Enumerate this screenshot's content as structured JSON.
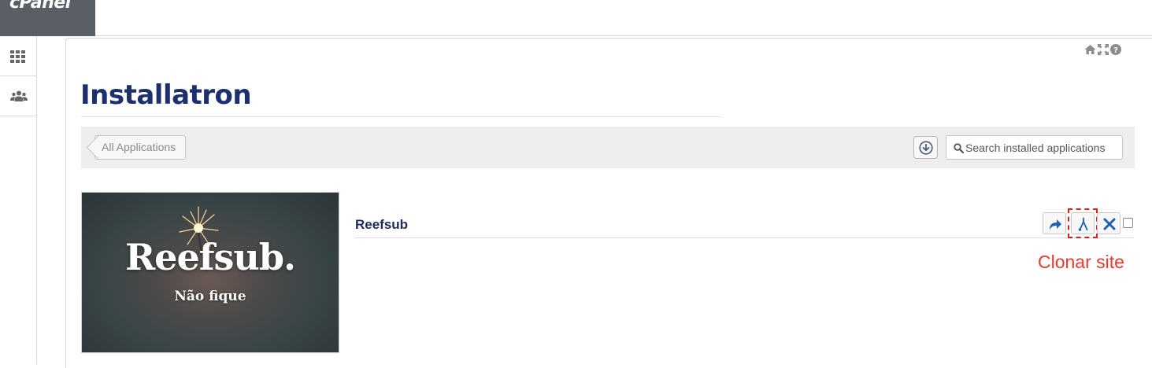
{
  "app": {
    "logo_text": "cPanel"
  },
  "sidebar": {
    "items": [
      {
        "icon": "grid-icon"
      },
      {
        "icon": "users-icon"
      }
    ]
  },
  "top_icons": [
    "home-icon",
    "expand-icon",
    "help-icon"
  ],
  "installatron": {
    "logo_text": "Installatron"
  },
  "toolbar": {
    "back_label": "All Applications",
    "search_placeholder": "Search installed applications"
  },
  "installation": {
    "title": "Reefsub",
    "thumbnail": {
      "headline": "Reefsub.",
      "subheadline": "Não fique"
    },
    "actions": [
      "share-icon",
      "clone-icon",
      "delete-icon"
    ]
  },
  "annotation": {
    "label": "Clonar site",
    "color": "#e53a2f"
  },
  "colors": {
    "logo_blue": "#1e2f6e",
    "title_navy": "#1e2b55",
    "action_blue": "#1f5fae",
    "highlight_red": "#e02020"
  }
}
